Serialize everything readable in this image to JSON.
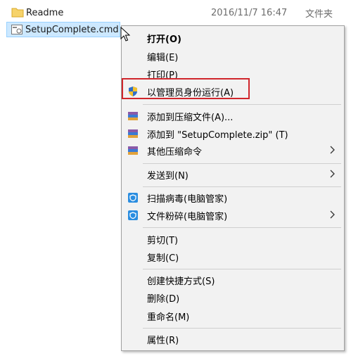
{
  "files": {
    "readme": {
      "name": "Readme",
      "date": "2016/11/7 16:47",
      "type": "文件夹"
    },
    "cmd": {
      "name": "SetupComplete.cmd"
    }
  },
  "menu": {
    "open": "打开(O)",
    "edit": "编辑(E)",
    "print": "打印(P)",
    "run_as_admin": "以管理员身份运行(A)",
    "add_to_archive": "添加到压缩文件(A)...",
    "add_to_zip": "添加到 \"SetupComplete.zip\" (T)",
    "other_compress": "其他压缩命令",
    "send_to": "发送到(N)",
    "scan_virus": "扫描病毒(电脑管家)",
    "shred_file": "文件粉碎(电脑管家)",
    "cut": "剪切(T)",
    "copy": "复制(C)",
    "create_shortcut": "创建快捷方式(S)",
    "delete": "删除(D)",
    "rename": "重命名(M)",
    "properties": "属性(R)"
  },
  "colors": {
    "highlight_border": "#d0262c",
    "selection_bg": "#cce8ff"
  }
}
